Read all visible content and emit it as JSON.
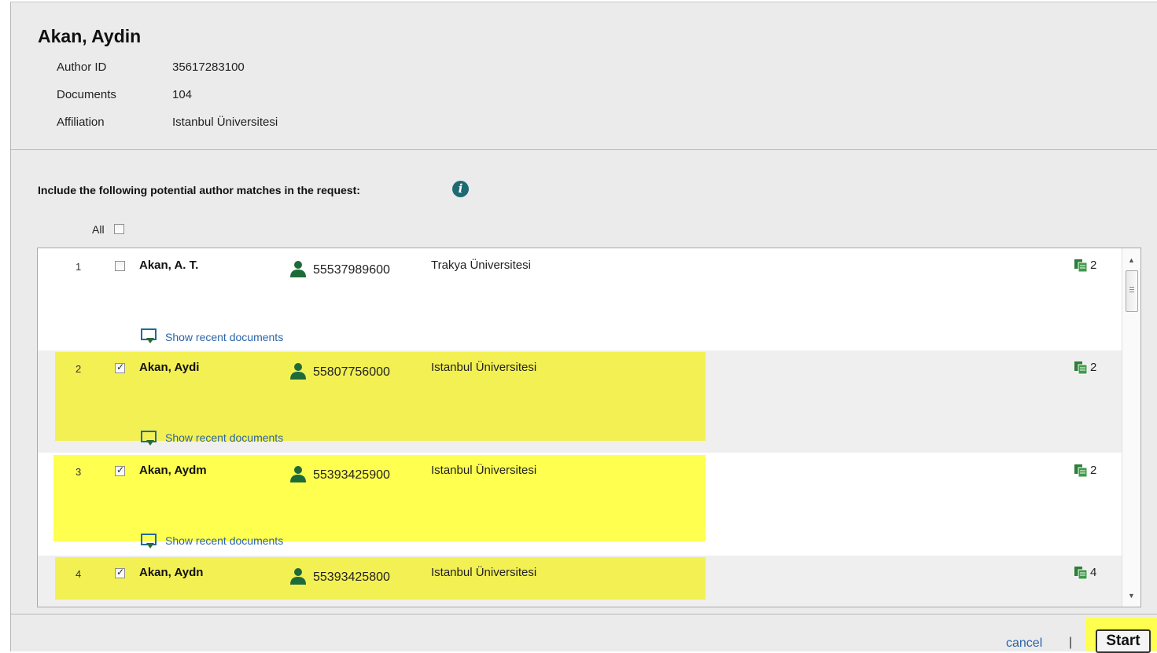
{
  "author": {
    "name": "Akan, Aydin",
    "meta": [
      {
        "label": "Author ID",
        "value": "35617283100"
      },
      {
        "label": "Documents",
        "value": "104"
      },
      {
        "label": "Affiliation",
        "value": "Istanbul Üniversitesi"
      }
    ]
  },
  "include_text": "Include the following potential author matches in the request:",
  "all_label": "All",
  "rows": [
    {
      "num": "1",
      "name": "Akan, A. T.",
      "id": "55537989600",
      "affiliation": "Trakya Üniversitesi",
      "docs": "2",
      "checked": false,
      "show_link": "Show recent documents"
    },
    {
      "num": "2",
      "name": "Akan, Aydi",
      "id": "55807756000",
      "affiliation": "Istanbul Üniversitesi",
      "docs": "2",
      "checked": true,
      "show_link": "Show recent documents"
    },
    {
      "num": "3",
      "name": "Akan, Aydm",
      "id": "55393425900",
      "affiliation": "Istanbul Üniversitesi",
      "docs": "2",
      "checked": true,
      "show_link": "Show recent documents"
    },
    {
      "num": "4",
      "name": "Akan, Aydn",
      "id": "55393425800",
      "affiliation": "Istanbul Üniversitesi",
      "docs": "4",
      "checked": true
    }
  ],
  "footer": {
    "cancel": "cancel",
    "separator": "|",
    "start": "Start"
  },
  "colors": {
    "highlight": "#ffff4f",
    "link": "#2b64a8",
    "icon_green": "#1e6b3a"
  },
  "icons": {
    "info": "info-icon",
    "person": "person-icon",
    "documents": "documents-icon",
    "show_recent": "show-recent-icon"
  }
}
